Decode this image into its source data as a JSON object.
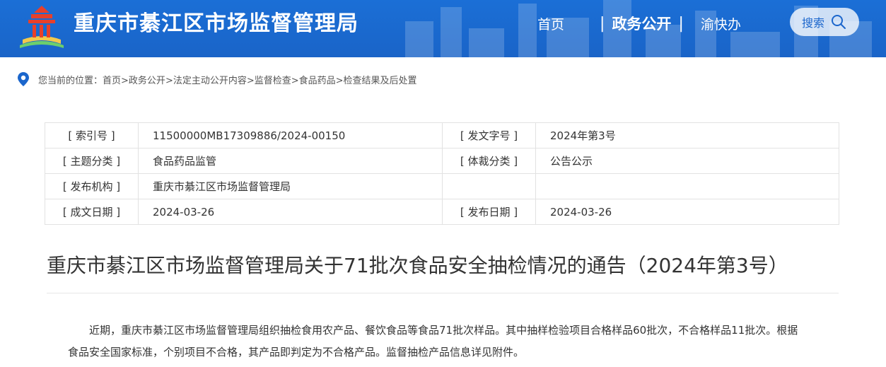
{
  "header": {
    "site_title": "重庆市綦江区市场监督管理局",
    "nav": [
      "首页",
      "政务公开",
      "渝快办"
    ],
    "search_label": "搜索"
  },
  "breadcrumb": {
    "prefix": "您当前的位置：",
    "items": [
      "首页",
      ">政务公开",
      ">法定主动公开内容",
      ">监督检查",
      ">食品药品",
      ">检查结果及后处置"
    ]
  },
  "info": {
    "rows": [
      {
        "k1": "[ 索引号 ]",
        "v1": "11500000MB17309886/2024-00150",
        "k2": "[ 发文字号 ]",
        "v2": "2024年第3号"
      },
      {
        "k1": "[ 主题分类 ]",
        "v1": "食品药品监管",
        "k2": "[ 体裁分类 ]",
        "v2": "公告公示"
      },
      {
        "k1": "[ 发布机构 ]",
        "v1": "重庆市綦江区市场监督管理局",
        "k2": "",
        "v2": ""
      },
      {
        "k1": "[ 成文日期 ]",
        "v1": "2024-03-26",
        "k2": "[ 发布日期 ]",
        "v2": "2024-03-26"
      }
    ]
  },
  "document": {
    "title": "重庆市綦江区市场监督管理局关于71批次食品安全抽检情况的通告（2024年第3号）",
    "paragraph": "近期，重庆市綦江区市场监督管理局组织抽检食用农产品、餐饮食品等食品71批次样品。其中抽样检验项目合格样品60批次，不合格样品11批次。根据食品安全国家标准，个别项目不合格，其产品即判定为不合格产品。监督抽检产品信息详见附件。"
  },
  "colors": {
    "header_bg": "#1b6fd6",
    "accent": "#1b66cc"
  }
}
